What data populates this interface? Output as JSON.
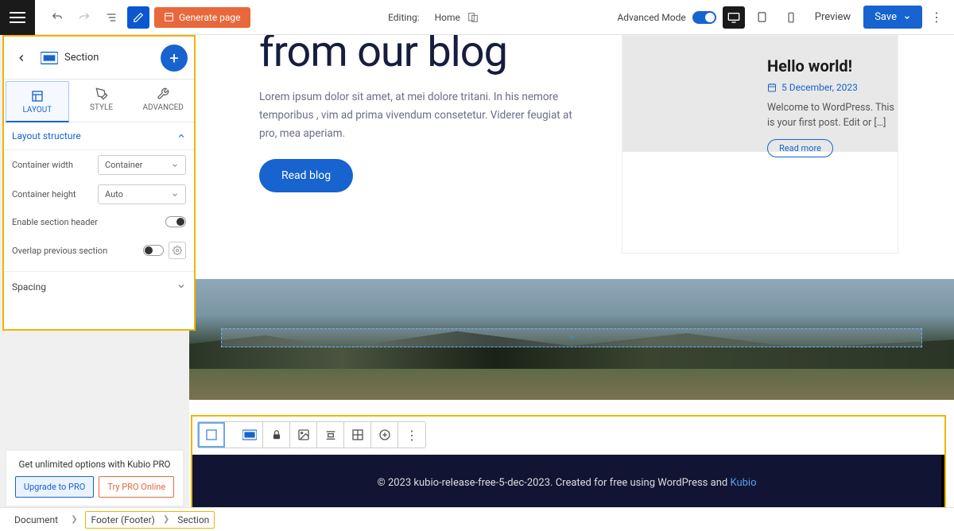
{
  "topbar": {
    "generate_label": "Generate page",
    "editing_prefix": "Editing:",
    "editing_page": "Home",
    "advanced_mode": "Advanced Mode",
    "preview": "Preview",
    "save": "Save"
  },
  "sidebar": {
    "title": "Section",
    "tabs": {
      "layout": "LAYOUT",
      "style": "STYLE",
      "advanced": "ADVANCED"
    },
    "layout_structure_hd": "Layout structure",
    "container_width_label": "Container width",
    "container_width_value": "Container",
    "container_height_label": "Container height",
    "container_height_value": "Auto",
    "enable_header": "Enable section header",
    "overlap_prev": "Overlap previous section",
    "spacing_hd": "Spacing"
  },
  "blog": {
    "title_fragment": "from our blog",
    "desc": "Lorem ipsum dolor sit amet, at mei dolore tritani. In his nemore temporibus , vim ad prima vivendum consetetur. Viderer feugiat at pro, mea aperiam.",
    "read_blog": "Read blog",
    "card": {
      "title": "Hello world!",
      "date": "5 December, 2023",
      "excerpt": "Welcome to WordPress. This is your first post. Edit or […]",
      "read_more": "Read more"
    }
  },
  "insert": {
    "blank": "Add blank section",
    "predesigned": "Add predesigned section",
    "ai": "Generate with AI"
  },
  "footer": {
    "text_prefix": "© 2023 kubio-release-free-5-dec-2023. Created for free using WordPress and ",
    "link": "Kubio"
  },
  "pro": {
    "text": "Get unlimited options with Kubio PRO",
    "upgrade": "Upgrade to PRO",
    "try": "Try PRO Online"
  },
  "breadcrumb": {
    "doc": "Document",
    "footer": "Footer (Footer)",
    "section": "Section"
  }
}
